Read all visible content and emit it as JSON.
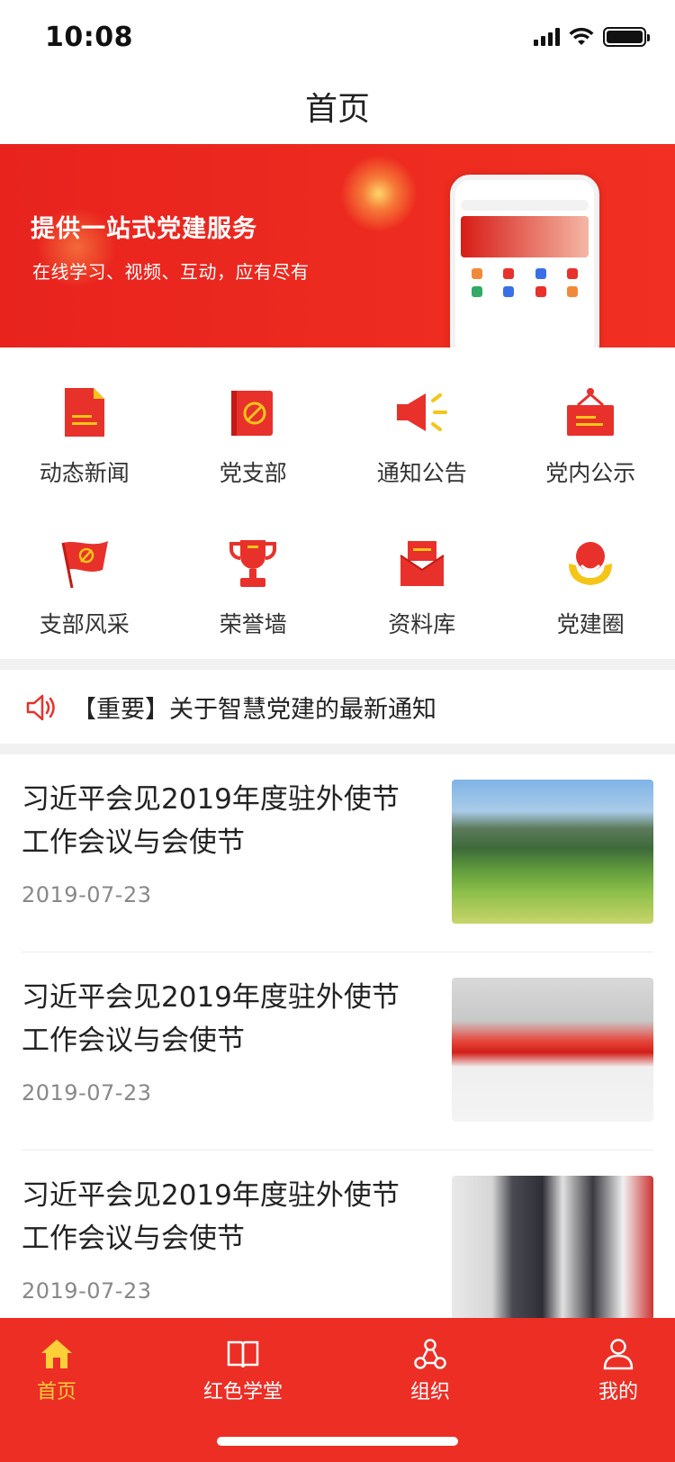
{
  "status_bar": {
    "time": "10:08"
  },
  "nav": {
    "title": "首页"
  },
  "banner": {
    "title": "提供一站式党建服务",
    "subtitle": "在线学习、视频、互动，应有尽有"
  },
  "grid": [
    {
      "label": "动态新闻",
      "icon": "news-document-icon"
    },
    {
      "label": "党支部",
      "icon": "party-book-icon"
    },
    {
      "label": "通知公告",
      "icon": "megaphone-icon"
    },
    {
      "label": "党内公示",
      "icon": "notice-board-icon"
    },
    {
      "label": "支部风采",
      "icon": "party-flag-icon"
    },
    {
      "label": "荣誉墙",
      "icon": "trophy-icon"
    },
    {
      "label": "资料库",
      "icon": "mail-archive-icon"
    },
    {
      "label": "党建圈",
      "icon": "community-person-icon"
    }
  ],
  "notice": {
    "text": "【重要】关于智慧党建的最新通知",
    "icon": "speaker-icon"
  },
  "news": [
    {
      "title": "习近平会见2019年度驻外使节工作会议与会使节",
      "date": "2019-07-23",
      "thumb": "mountain-meadow"
    },
    {
      "title": "习近平会见2019年度驻外使节工作会议与会使节",
      "date": "2019-07-23",
      "thumb": "red-slogan-wall"
    },
    {
      "title": "习近平会见2019年度驻外使节工作会议与会使节",
      "date": "2019-07-23",
      "thumb": "exhibition-visit"
    }
  ],
  "tabbar": [
    {
      "label": "首页",
      "icon": "home-icon",
      "active": true
    },
    {
      "label": "红色学堂",
      "icon": "book-icon",
      "active": false
    },
    {
      "label": "组织",
      "icon": "organization-icon",
      "active": false
    },
    {
      "label": "我的",
      "icon": "user-icon",
      "active": false
    }
  ],
  "colors": {
    "brand_red": "#ec2e25",
    "active_tab": "#ffcf3a",
    "icon_yellow": "#f5c518"
  }
}
